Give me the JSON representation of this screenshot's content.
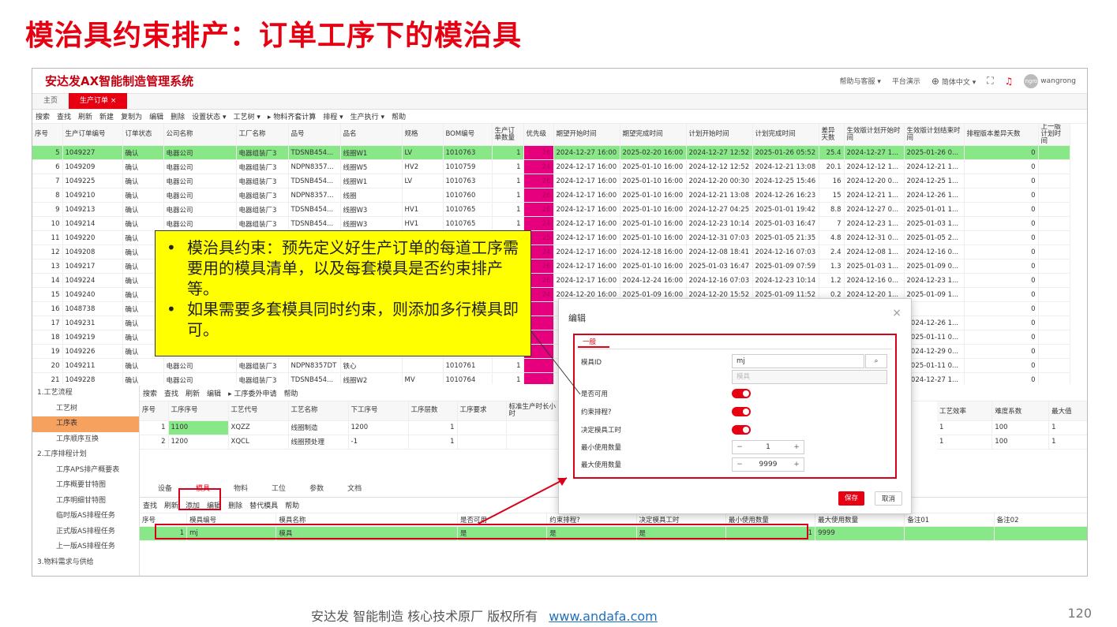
{
  "slide": {
    "title": "模治具约束排产：订单工序下的模治具",
    "footer_text": "安达发   智能制造 核心技术原厂   版权所有",
    "footer_link": "www.andafa.com",
    "page_number": "120"
  },
  "app": {
    "brand": "安达发AX智能制造管理系统",
    "help": "帮助与客服 ▾",
    "demo": "平台演示",
    "lang": "简体中文 ▾",
    "avatar_text": "ngro",
    "username": "wangrong"
  },
  "tabs": [
    {
      "label": "主页"
    },
    {
      "label": "生产订单 ×"
    }
  ],
  "toolbar": [
    "搜索",
    "查找",
    "刷新",
    "新建",
    "复制为",
    "编辑",
    "删除",
    "设置状态 ▾",
    "工艺树 ▾",
    "▸ 物料齐套计算",
    "排程 ▾",
    "生产执行 ▾",
    "帮助"
  ],
  "columns": [
    "序号",
    "生产订单编号",
    "订单状态",
    "公司名称",
    "工厂名称",
    "品号",
    "品名",
    "规格",
    "BOM编号",
    "生产订单数量",
    "优先级",
    "期望开始时间",
    "期望完成时间",
    "计划开始时间",
    "计划完成时间",
    "差异天数",
    "生效版计划开始时间",
    "生效版计划结束时间",
    "排程版本差异天数",
    "上一版计划时间"
  ],
  "rows": [
    [
      "5",
      "1049227",
      "确认",
      "电器公司",
      "电器组装厂3",
      "TDSNB454...",
      "线圈W1",
      "LV",
      "1010763",
      "1",
      "26",
      "2024-12-27 16:00",
      "2025-02-20 16:00",
      "2024-12-27 12:52",
      "2025-01-26 05:52",
      "25.4",
      "2024-12-27 1...",
      "2025-01-26 0...",
      "0",
      ""
    ],
    [
      "6",
      "1049209",
      "确认",
      "电器公司",
      "电器组装厂3",
      "NDPN8357...",
      "线圈W5",
      "HV2",
      "1010759",
      "1",
      "24",
      "2024-12-17 16:00",
      "2025-01-10 16:00",
      "2024-12-12 12:52",
      "2024-12-21 13:08",
      "20.1",
      "2024-12-12 1...",
      "2024-12-21 1...",
      "0",
      ""
    ],
    [
      "7",
      "1049225",
      "确认",
      "电器公司",
      "电器组装厂3",
      "TDSNB454...",
      "线圈W1",
      "LV",
      "1010763",
      "1",
      "26",
      "2024-12-17 16:00",
      "2025-01-10 16:00",
      "2024-12-20 00:30",
      "2024-12-25 15:46",
      "16",
      "2024-12-20 0...",
      "2024-12-25 1...",
      "0",
      ""
    ],
    [
      "8",
      "1049210",
      "确认",
      "电器公司",
      "电器组装厂3",
      "NDPN8357...",
      "线圈",
      "",
      "1010760",
      "1",
      "26",
      "2024-12-17 16:00",
      "2025-01-10 16:00",
      "2024-12-21 13:08",
      "2024-12-26 16:23",
      "15",
      "2024-12-21 1...",
      "2024-12-26 1...",
      "0",
      ""
    ],
    [
      "9",
      "1049213",
      "确认",
      "电器公司",
      "电器组装厂3",
      "TDSNB454...",
      "线圈W3",
      "HV1",
      "1010765",
      "1",
      "26",
      "2024-12-17 16:00",
      "2025-01-10 16:00",
      "2024-12-27 04:25",
      "2025-01-01 19:42",
      "8.8",
      "2024-12-27 0...",
      "2025-01-01 1...",
      "0",
      ""
    ],
    [
      "10",
      "1049214",
      "确认",
      "电器公司",
      "电器组装厂3",
      "TDSNB454...",
      "线圈W3",
      "HV1",
      "1010765",
      "1",
      "24",
      "2024-12-17 16:00",
      "2025-01-10 16:00",
      "2024-12-23 10:14",
      "2025-01-03 16:47",
      "7",
      "2024-12-23 1...",
      "2025-01-03 1...",
      "0",
      ""
    ],
    [
      "11",
      "1049220",
      "确认",
      "",
      "",
      "",
      "",
      "",
      "",
      "",
      "25",
      "2024-12-17 16:00",
      "2025-01-10 16:00",
      "2024-12-31 07:03",
      "2025-01-05 21:35",
      "4.8",
      "2024-12-31 0...",
      "2025-01-05 2...",
      "0",
      ""
    ],
    [
      "12",
      "1049208",
      "确认",
      "",
      "",
      "",
      "",
      "",
      "",
      "",
      "24",
      "2024-12-17 16:00",
      "2024-12-18 16:00",
      "2024-12-08 18:41",
      "2024-12-16 07:03",
      "2.4",
      "2024-12-08 1...",
      "2024-12-16 0...",
      "0",
      ""
    ],
    [
      "13",
      "1049217",
      "确认",
      "",
      "",
      "",
      "",
      "",
      "",
      "",
      "26",
      "2024-12-17 16:00",
      "2025-01-10 16:00",
      "2025-01-03 16:47",
      "2025-01-09 07:59",
      "1.3",
      "2025-01-03 1...",
      "2025-01-09 0...",
      "0",
      ""
    ],
    [
      "14",
      "1049224",
      "确认",
      "",
      "",
      "",
      "",
      "",
      "",
      "",
      "26",
      "2024-12-17 16:00",
      "2024-12-24 16:00",
      "2024-12-16 07:03",
      "2024-12-23 10:14",
      "1.2",
      "2024-12-16 0...",
      "2024-12-23 1...",
      "0",
      ""
    ],
    [
      "15",
      "1049240",
      "确认",
      "",
      "",
      "",
      "",
      "",
      "",
      "",
      "24",
      "2024-12-20 16:00",
      "2025-01-09 16:00",
      "2024-12-20 15:52",
      "2025-01-09 11:52",
      "0.2",
      "2024-12-20 1...",
      "2025-01-09 1...",
      "0",
      ""
    ],
    [
      "16",
      "1048738",
      "确认",
      "",
      "",
      "",
      "",
      "",
      "",
      "",
      "",
      "",
      "",
      "",
      "",
      "",
      "",
      "",
      "0",
      ""
    ],
    [
      "17",
      "1049231",
      "确认",
      "",
      "",
      "",
      "",
      "",
      "",
      "",
      "",
      "",
      "",
      "",
      "",
      "",
      "",
      "2024-12-26 1...",
      "0",
      ""
    ],
    [
      "18",
      "1049219",
      "确认",
      "",
      "",
      "",
      "",
      "",
      "",
      "",
      "",
      "",
      "",
      "",
      "",
      "",
      "",
      "2025-01-11 0...",
      "0",
      ""
    ],
    [
      "19",
      "1049226",
      "确认",
      "",
      "",
      "",
      "",
      "",
      "",
      "",
      "",
      "",
      "",
      "",
      "",
      "",
      "",
      "2024-12-29 0...",
      "0",
      ""
    ],
    [
      "20",
      "1049211",
      "确认",
      "电器公司",
      "电器组装厂3",
      "NDPN8357DT",
      "铁心",
      "",
      "1010761",
      "1",
      "",
      "",
      "",
      "",
      "",
      "",
      "",
      "2025-01-11 0...",
      "0",
      ""
    ],
    [
      "21",
      "1049228",
      "确认",
      "电器公司",
      "电器组装厂3",
      "TDSNB454...",
      "线圈W2",
      "MV",
      "1010764",
      "1",
      "",
      "",
      "",
      "",
      "",
      "",
      "",
      "2024-12-27 1...",
      "0",
      ""
    ]
  ],
  "callout": [
    "模治具约束：预先定义好生产订单的每道工序需要用的模具清单，以及每套模具是否约束排产等。",
    "如果需要多套模具同时约束，则添加多行模具即可。"
  ],
  "nav": [
    {
      "label": "1.工艺流程",
      "group": true
    },
    {
      "label": "工艺树"
    },
    {
      "label": "工序表",
      "active": true
    },
    {
      "label": "工序顺序互换"
    },
    {
      "label": "2.工序排程计划",
      "group": true
    },
    {
      "label": "工序APS排产概要表"
    },
    {
      "label": "工序概要甘特图"
    },
    {
      "label": "工序明细甘特图"
    },
    {
      "label": "临时版AS排程任务"
    },
    {
      "label": "正式版AS排程任务"
    },
    {
      "label": "上一版AS排程任务"
    },
    {
      "label": "3.物料需求与供给",
      "group": true
    }
  ],
  "proc_toolbar": [
    "搜索",
    "查找",
    "刷新",
    "编辑",
    "▸ 工序委外申请",
    "帮助"
  ],
  "proc_columns": [
    "序号",
    "工序序号",
    "工艺代号",
    "工艺名称",
    "下工序号",
    "工序层数",
    "工序要求",
    "标准生产时长小时"
  ],
  "proc_rows": [
    [
      "1",
      "1100",
      "XQZZ",
      "线圈制造",
      "1200",
      "1",
      ""
    ],
    [
      "2",
      "1200",
      "XQCL",
      "线圈预处理",
      "-1",
      "1",
      ""
    ]
  ],
  "proc_right_columns": [
    "工艺效率",
    "难度系数",
    "最大值"
  ],
  "proc_right_rows": [
    [
      "1",
      "100",
      "1"
    ],
    [
      "1",
      "100",
      "1"
    ]
  ],
  "subtabs": [
    "设备",
    "模具",
    "物料",
    "工位",
    "参数",
    "文档"
  ],
  "mold_toolbar": [
    "查找",
    "刷新",
    "添加",
    "编辑",
    "删除",
    "替代模具",
    "帮助"
  ],
  "mold_columns": [
    "序号",
    "模具编号",
    "模具名称",
    "是否可用",
    "约束排程?",
    "决定模具工时",
    "最小使用数量",
    "最大使用数量",
    "备注01",
    "备注02"
  ],
  "mold_rows": [
    [
      "1",
      "mj",
      "模具",
      "是",
      "是",
      "是",
      "1",
      "9999",
      "",
      ""
    ]
  ],
  "dialog": {
    "title": "编辑",
    "tab": "一般",
    "mold_id_label": "模具ID",
    "mold_id_value": "mj",
    "mold_name_placeholder": "模具",
    "available_label": "是否可用",
    "constraint_label": "约束排程?",
    "decide_time_label": "决定模具工时",
    "min_label": "最小使用数量",
    "min_value": "1",
    "max_label": "最大使用数量",
    "max_value": "9999",
    "save": "保存",
    "cancel": "取消"
  },
  "colors": {
    "accent": "#e60012",
    "highlight": "#ffff00",
    "selected_row": "#88e888",
    "priority": "#e6007e"
  }
}
